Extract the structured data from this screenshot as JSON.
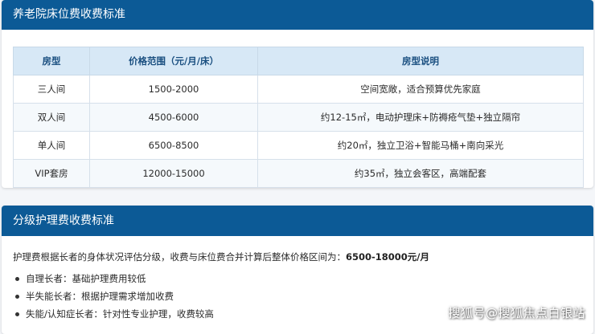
{
  "bed_section": {
    "title": "养老院床位费收费标准",
    "headers": [
      "房型",
      "价格范围（元/月/床）",
      "房型说明"
    ],
    "rows": [
      [
        "三人间",
        "1500-2000",
        "空间宽敞，适合预算优先家庭"
      ],
      [
        "双人间",
        "4500-6000",
        "约12-15㎡，电动护理床+防褥疮气垫+独立隔帘"
      ],
      [
        "单人间",
        "6500-8500",
        "约20㎡，独立卫浴+智能马桶+南向采光"
      ],
      [
        "VIP套房",
        "12000-15000",
        "约35㎡，独立会客区，高端配套"
      ]
    ]
  },
  "care_section": {
    "title": "分级护理费收费标准",
    "intro": "护理费根据长者的身体状况评估分级，收费与床位费合并计算后整体价格区间为：",
    "intro_value": "6500-18000元/月",
    "items": [
      "自理长者：基础护理费用较低",
      "半失能长者：根据护理需求增加收费",
      "失能/认知症长者：针对性专业护理，收费较高"
    ]
  },
  "watermark": "搜狐号@搜狐焦点白银站"
}
